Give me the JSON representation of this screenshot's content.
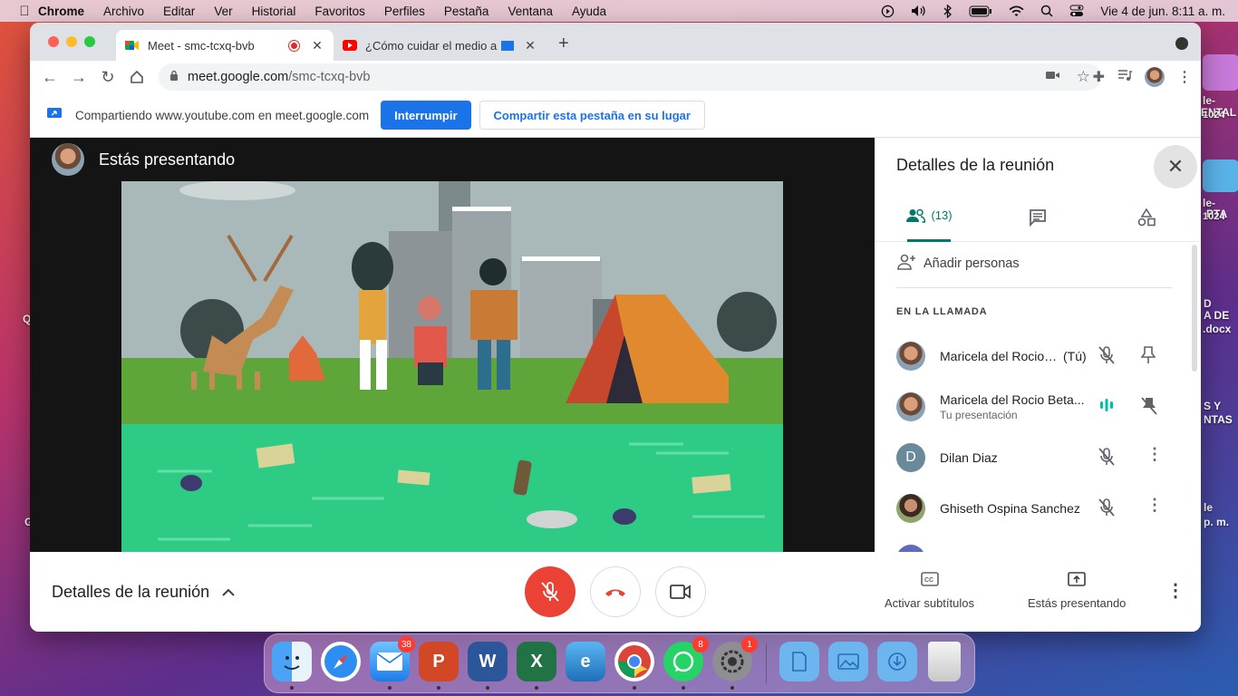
{
  "menubar": {
    "app": "Chrome",
    "items": [
      "Archivo",
      "Editar",
      "Ver",
      "Historial",
      "Favoritos",
      "Perfiles",
      "Pestaña",
      "Ventana",
      "Ayuda"
    ],
    "datetime": "Vie 4 de jun.  8:11 a. m."
  },
  "tabs": [
    {
      "title": "Meet - smc-tcxq-bvb",
      "icon": "google-meet-icon",
      "recording": true
    },
    {
      "title": "¿Cómo cuidar el medio am",
      "icon": "youtube-icon"
    }
  ],
  "address": {
    "host": "meet.google.com",
    "path": "/smc-tcxq-bvb"
  },
  "infobar": {
    "text": "Compartiendo www.youtube.com en meet.google.com",
    "stop_label": "Interrumpir",
    "share_label": "Compartir esta pestaña en su lugar"
  },
  "stage": {
    "presenting_label": "Estás presentando"
  },
  "panel": {
    "title": "Detalles de la reunión",
    "people_count": "(13)",
    "add_people": "Añadir personas",
    "section": "EN LA LLAMADA",
    "participants": [
      {
        "name": "Maricela del Rocio ...",
        "tag": "(Tú)",
        "sub": ""
      },
      {
        "name": "Maricela del Rocio Beta...",
        "tag": "",
        "sub": "Tu presentación"
      },
      {
        "name": "Dilan Diaz",
        "tag": "",
        "sub": "",
        "initial": "D"
      },
      {
        "name": "Ghiseth Ospina Sanchez",
        "tag": "",
        "sub": ""
      }
    ]
  },
  "bottom": {
    "details": "Detalles de la reunión",
    "captions": "Activar subtítulos",
    "presenting": "Estás presentando"
  },
  "dock": {
    "badges": {
      "mail": "38",
      "whatsapp": "8",
      "settings": "1"
    }
  },
  "colors": {
    "meet_teal": "#00796b",
    "chrome_blue": "#1a73e8",
    "end_call_red": "#ea4335"
  },
  "desktop": {
    "labels": [
      "le-",
      "ENTAL",
      "1024",
      "le-",
      "PTA",
      "1024",
      "D",
      "A DE",
      ".docx",
      "S Y",
      "NTAS",
      "le",
      "p. m.",
      "Q",
      "G"
    ]
  }
}
